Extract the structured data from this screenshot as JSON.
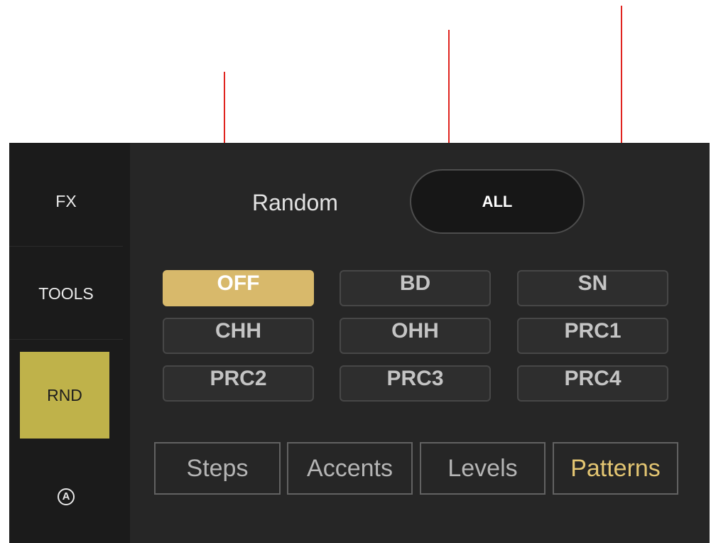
{
  "sidebar": {
    "items": [
      {
        "label": "FX"
      },
      {
        "label": "TOOLS"
      },
      {
        "label": "RND"
      }
    ],
    "icon_glyph": "A"
  },
  "random": {
    "label": "Random",
    "mode_button": "ALL"
  },
  "instruments": [
    "OFF",
    "BD",
    "SN",
    "CHH",
    "OHH",
    "PRC1",
    "PRC2",
    "PRC3",
    "PRC4"
  ],
  "selected_instrument": "OFF",
  "tabs": [
    "Steps",
    "Accents",
    "Levels",
    "Patterns"
  ],
  "active_tab": "Patterns",
  "colors": {
    "accent": "#bfb24a",
    "selected_chip": "#d8b96b",
    "active_tab_text": "#e3c572",
    "annotation_arrow": "#e0241f"
  }
}
